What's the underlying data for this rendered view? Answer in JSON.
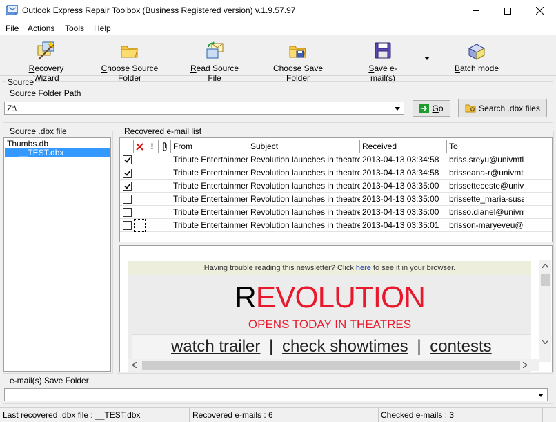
{
  "window": {
    "title": "Outlook Express Repair Toolbox (Business Registered version) v.1.9.57.97",
    "min_glyph": "—",
    "max_glyph": "☐",
    "close_glyph": "✕"
  },
  "menu": {
    "file": {
      "u": "F",
      "rest": "ile"
    },
    "actions": {
      "u": "A",
      "rest": "ctions"
    },
    "tools": {
      "u": "T",
      "rest": "ools"
    },
    "help": {
      "u": "H",
      "rest": "elp"
    }
  },
  "toolbar": {
    "recovery_wizard": {
      "u": "R",
      "rest": "ecovery Wizard"
    },
    "choose_source_folder": {
      "u": "C",
      "rest": "hoose Source Folder"
    },
    "read_source_file": {
      "u": "R",
      "rest": "ead Source File"
    },
    "choose_save_folder": {
      "pre": "Choose Save Fo",
      "u": "l",
      "rest": "der"
    },
    "save_emails": {
      "u": "S",
      "rest": "ave e-mail(s)"
    },
    "batch_mode": {
      "u": "B",
      "rest": "atch mode"
    }
  },
  "source": {
    "group_label": "Source",
    "folder_path_label": "Source Folder Path",
    "folder_path_value": "Z:\\",
    "go_button": {
      "u": "G",
      "rest": "o"
    },
    "search_button": "Search .dbx files"
  },
  "dbx_panel": {
    "label": "Source .dbx file",
    "files": [
      "Thumbs.db",
      "__TEST.dbx"
    ],
    "selected_index": 1
  },
  "email_list": {
    "label": "Recovered e-mail list",
    "header_icons": {
      "deleted": "✕",
      "priority": "!",
      "attachment": "attachment"
    },
    "columns": [
      "From",
      "Subject",
      "Received",
      "To"
    ],
    "rows": [
      {
        "checked": true,
        "from": "Tribute Entertainment",
        "subject": "Revolution launches in theatres",
        "received": "2013-04-13 03:34:58",
        "to": "briss.sreyu@univmtl"
      },
      {
        "checked": true,
        "from": "Tribute Entertainment",
        "subject": "Revolution launches in theatres",
        "received": "2013-04-13 03:34:58",
        "to": "brisseana-r@univmt"
      },
      {
        "checked": true,
        "from": "Tribute Entertainment",
        "subject": "Revolution launches in theatres",
        "received": "2013-04-13 03:35:00",
        "to": "brissetteceste@univ"
      },
      {
        "checked": false,
        "from": "Tribute Entertainment",
        "subject": "Revolution launches in theatres",
        "received": "2013-04-13 03:35:00",
        "to": "brissette_maria-susa"
      },
      {
        "checked": false,
        "from": "Tribute Entertainment",
        "subject": "Revolution launches in theatres",
        "received": "2013-04-13 03:35:00",
        "to": "brisso.dianel@univm"
      },
      {
        "checked": false,
        "from": "Tribute Entertainment",
        "subject": "Revolution launches in theatres",
        "received": "2013-04-13 03:35:01",
        "to": "brisson-maryeveu@"
      }
    ]
  },
  "preview": {
    "trouble_pre": "Having trouble reading this newsletter? Click ",
    "trouble_link": "here",
    "trouble_post": " to see it in your browser.",
    "headline_first": "R",
    "headline_rest": "EVOLUTION",
    "subhead": "OPENS TODAY IN THEATRES",
    "links": [
      "watch trailer",
      "check showtimes",
      "contests"
    ],
    "link_sep": "|",
    "colors": {
      "red": "#e8192c",
      "bg": "#ececec",
      "banner": "#eeeeee"
    }
  },
  "save_folder": {
    "label": "e-mail(s) Save Folder",
    "value": ""
  },
  "status": {
    "last_file": "Last recovered .dbx file : __TEST.dbx",
    "recovered": "Recovered e-mails : 6",
    "checked": "Checked e-mails : 3"
  }
}
